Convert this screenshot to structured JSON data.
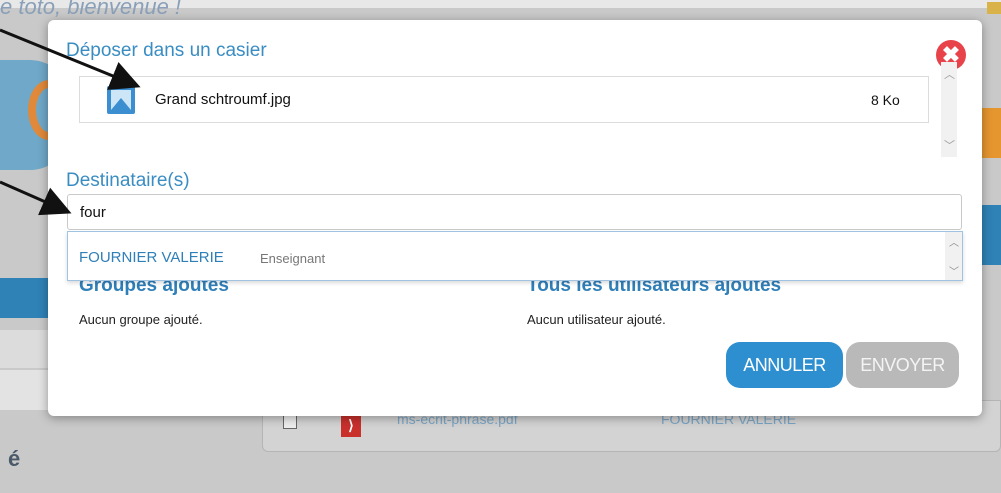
{
  "background": {
    "greeting": "e toto, bienvenue !",
    "row_file": "ms-ecrit-phrase.pdf",
    "row_owner": "FOURNIER VALERIE",
    "bottom_letter": "é"
  },
  "modal": {
    "title": "Déposer dans un casier",
    "close_glyph": "✖",
    "file": {
      "name": "Grand schtroumf.jpg",
      "size": "8 Ko",
      "icon": "image-file-icon"
    },
    "recipients": {
      "label": "Destinataire(s)",
      "input_value": "four"
    },
    "suggestion": {
      "name": "FOURNIER VALERIE",
      "role": "Enseignant"
    },
    "groups": {
      "title": "Groupes ajoutés",
      "empty": "Aucun groupe ajouté."
    },
    "users": {
      "title": "Tous les utilisateurs ajoutés",
      "empty": "Aucun utilisateur ajouté."
    },
    "buttons": {
      "cancel": "ANNULER",
      "send": "ENVOYER"
    }
  },
  "colors": {
    "accent": "#3a8dc3",
    "cancel_button": "#2d8fd0",
    "send_button_disabled": "#b9b9b9",
    "close_button": "#e8424a"
  }
}
